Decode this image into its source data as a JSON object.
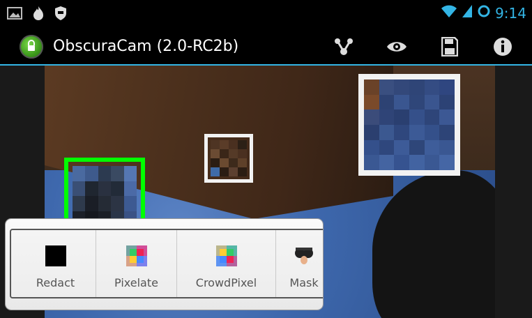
{
  "status_bar": {
    "time": "9:14",
    "icons": [
      "image-icon",
      "fire-icon",
      "shield-icon",
      "wifi-icon",
      "signal-icon",
      "sync-icon"
    ]
  },
  "action_bar": {
    "title": "ObscuraCam (2.0-RC2b)",
    "icons": [
      "share-icon",
      "preview-eye-icon",
      "save-icon",
      "info-icon"
    ]
  },
  "filters": [
    {
      "label": "Redact",
      "icon": "redact-icon"
    },
    {
      "label": "Pixelate",
      "icon": "pixelate-icon"
    },
    {
      "label": "CrowdPixel",
      "icon": "crowdpixel-icon"
    },
    {
      "label": "Mask",
      "icon": "mask-icon"
    }
  ],
  "colors": {
    "accent": "#33b5e5",
    "active_region": "#00ff00",
    "region": "#ffffff"
  }
}
